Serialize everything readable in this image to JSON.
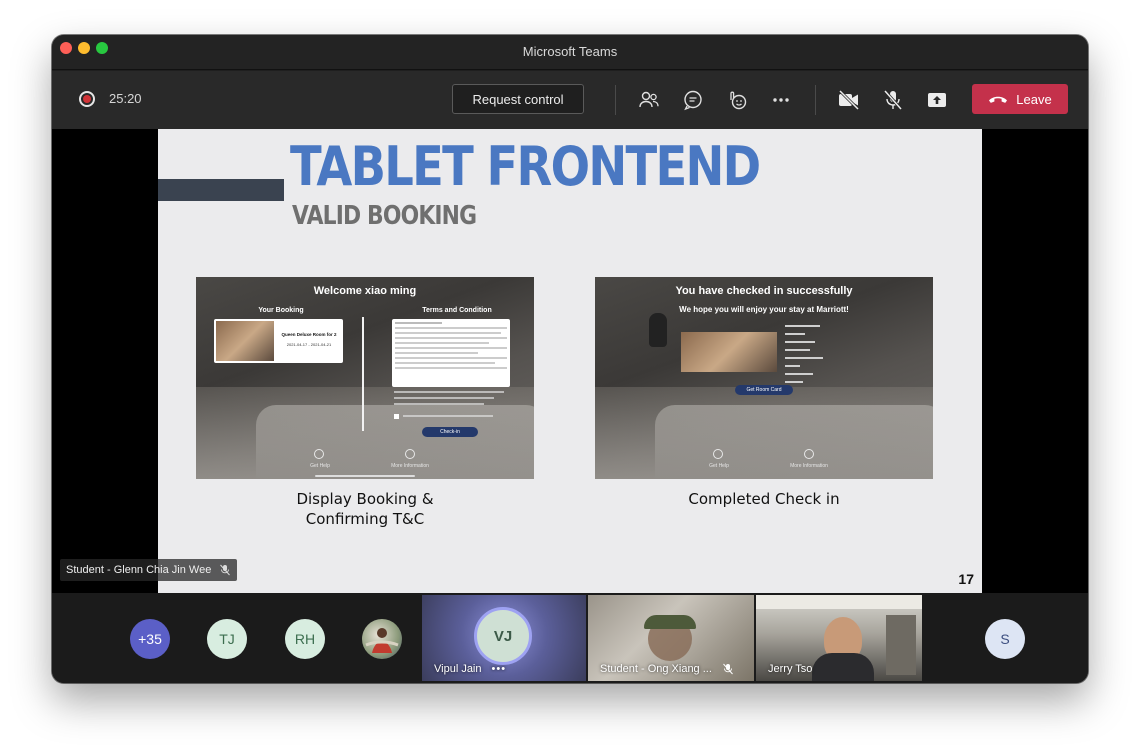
{
  "window": {
    "title": "Microsoft Teams"
  },
  "toolbar": {
    "timer": "25:20",
    "request_control_label": "Request control",
    "leave_label": "Leave",
    "icons": [
      "participants-icon",
      "chat-icon",
      "reactions-icon",
      "more-options-icon",
      "camera-off-icon",
      "mic-off-icon",
      "share-tray-icon",
      "hang-up-icon"
    ]
  },
  "slide": {
    "title": "TABLET FRONTEND",
    "subtitle": "VALID BOOKING",
    "page_number": "17",
    "left_screenshot": {
      "welcome": "Welcome xiao ming",
      "your_booking": "Your Booking",
      "terms_heading": "Terms and Condition",
      "room_name": "Queen Deluxe Room for 2",
      "dates": "2021-04-17 - 2021-04-21",
      "check_in_button": "Check-in",
      "get_help": "Get Help",
      "more_information": "More Information",
      "caption_line1": "Display Booking &",
      "caption_line2": "Confirming T&C"
    },
    "right_screenshot": {
      "heading": "You have checked in successfully",
      "subheading": "We hope you will enjoy your stay at Marriott!",
      "get_room_card_button": "Get Room Card",
      "get_help": "Get Help",
      "more_information": "More Information",
      "caption": "Completed Check in"
    }
  },
  "presenter": {
    "name": "Student - Glenn Chia Jin Wee"
  },
  "gallery": {
    "overflow_count": "+35",
    "avatars": [
      {
        "initials": "TJ",
        "color": "#d8ede0",
        "text_color": "#3c6e4f"
      },
      {
        "initials": "RH",
        "color": "#d8ede0",
        "text_color": "#3c6e4f"
      },
      {
        "initials": "S",
        "color": "#dde5f4",
        "text_color": "#3d4f80"
      }
    ],
    "tiles": [
      {
        "name": "Vipul Jain",
        "initials": "VJ"
      },
      {
        "name": "Student - Ong Xiang ..."
      },
      {
        "name": "Jerry Tso"
      }
    ]
  },
  "colors": {
    "leave": "#c4314b",
    "record": "#d13438",
    "overflow_avatar": "#5b5fc7",
    "slide_title": "#4a78c2"
  }
}
